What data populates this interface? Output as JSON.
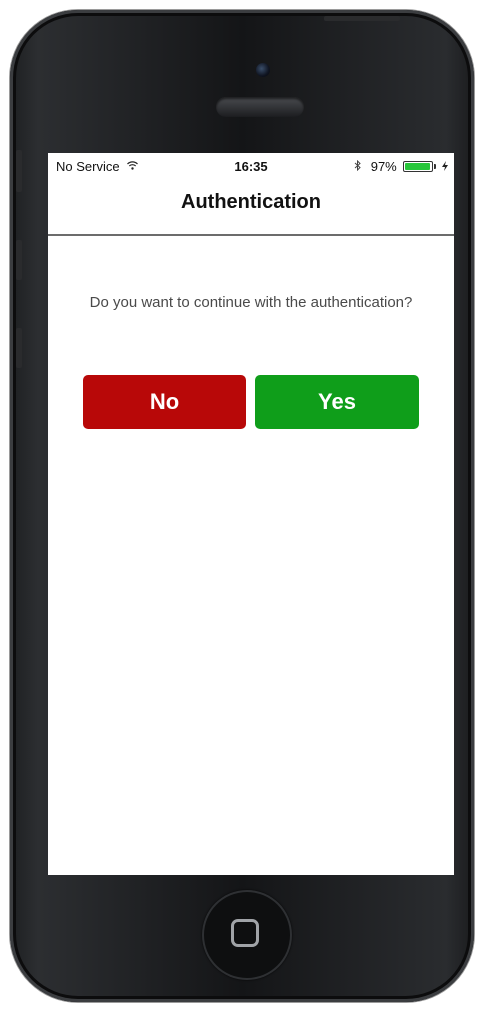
{
  "status_bar": {
    "carrier": "No Service",
    "wifi_icon": "wifi-icon",
    "time": "16:35",
    "bluetooth_icon": "bluetooth-icon",
    "battery_percent_text": "97%",
    "battery_level": 0.97,
    "battery_color": "#27c63a",
    "charging_icon": "charging-icon"
  },
  "nav": {
    "title": "Authentication"
  },
  "dialog": {
    "prompt": "Do you want to continue with the authentication?",
    "no_label": "No",
    "yes_label": "Yes",
    "no_color": "#b80808",
    "yes_color": "#0f9e1a"
  }
}
